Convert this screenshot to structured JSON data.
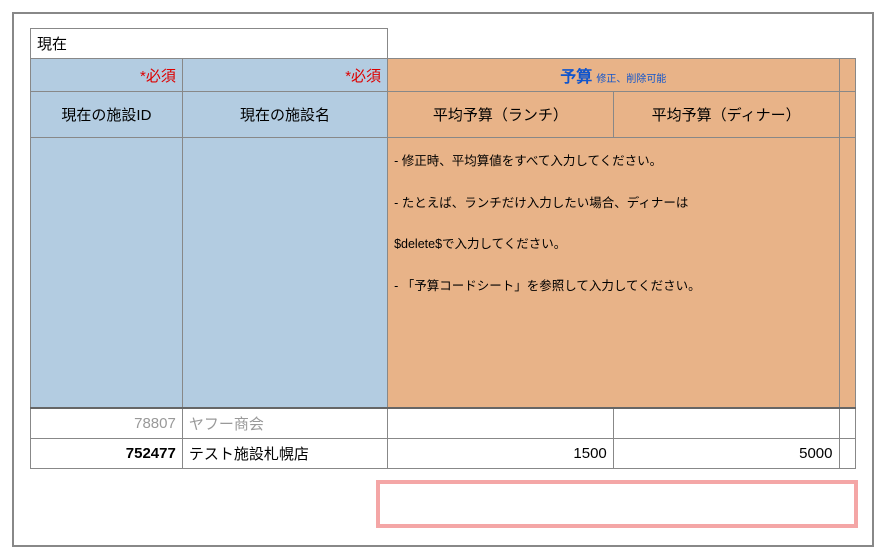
{
  "header": {
    "current_label": "現在",
    "required_mark": "*必須",
    "budget_title": "予算",
    "budget_subtitle": "修正、削除可能"
  },
  "columns": {
    "facility_id": "現在の施設ID",
    "facility_name": "現在の施設名",
    "avg_budget_lunch": "平均予算（ランチ）",
    "avg_budget_dinner": "平均予算（ディナー）"
  },
  "notes": {
    "line1": "- 修正時、平均算値をすべて入力してください。",
    "line2": "- たとえば、ランチだけ入力したい場合、ディナーは",
    "line3": "$delete$で入力してください。",
    "line4": "- 「予算コードシート」を参照して入力してください。"
  },
  "rows": [
    {
      "id": "78807",
      "name": "ヤフー商会",
      "lunch": "",
      "dinner": ""
    },
    {
      "id": "752477",
      "name": "テスト施設札幌店",
      "lunch": "1500",
      "dinner": "5000"
    }
  ]
}
